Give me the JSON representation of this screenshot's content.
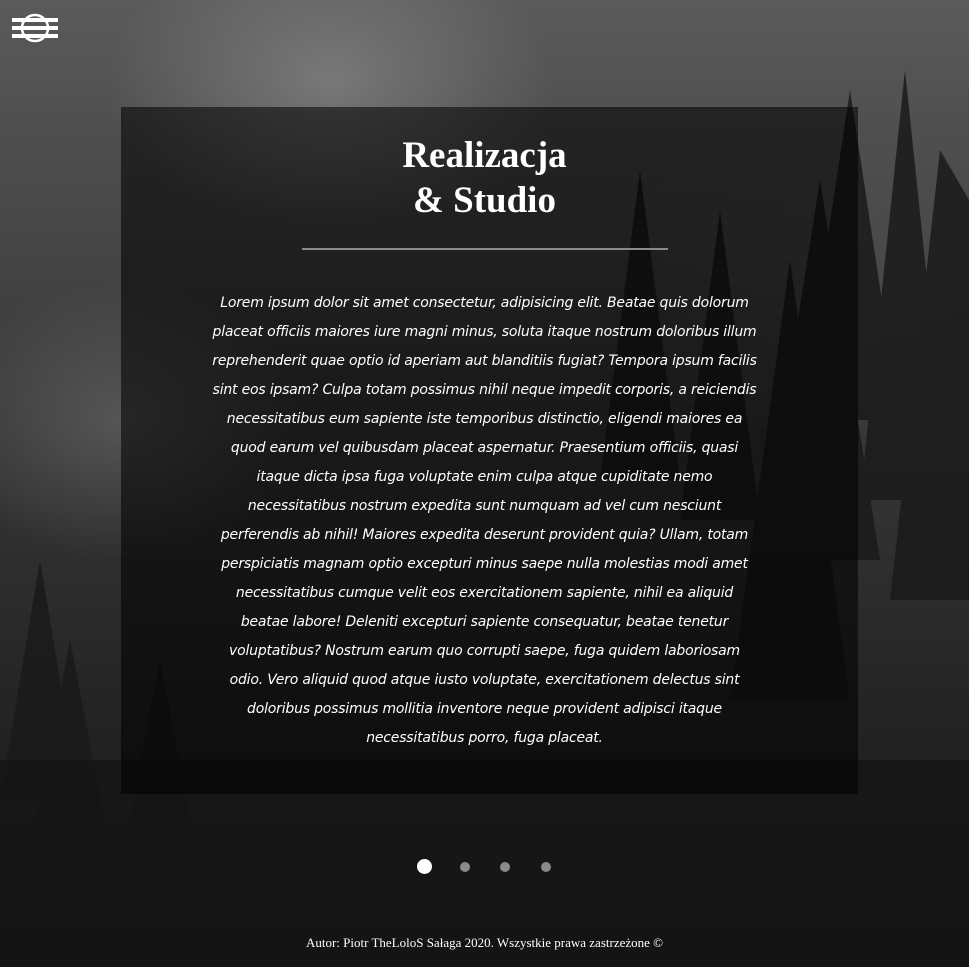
{
  "menu": {
    "icon": "hamburger-menu-icon"
  },
  "section": {
    "title_line1": "Realizacja",
    "title_line2": "& Studio",
    "text": "Lorem ipsum dolor sit amet consectetur, adipisicing elit. Beatae quis dolorum placeat officiis maiores iure magni minus, soluta itaque nostrum doloribus illum reprehenderit quae optio id aperiam aut blanditiis fugiat? Tempora ipsum facilis sint eos ipsam? Culpa totam possimus nihil neque impedit corporis, a reiciendis necessitatibus eum sapiente iste temporibus distinctio, eligendi maiores ea quod earum vel quibusdam placeat aspernatur. Praesentium officiis, quasi itaque dicta ipsa fuga voluptate enim culpa atque cupiditate nemo necessitatibus nostrum expedita sunt numquam ad vel cum nesciunt perferendis ab nihil! Maiores expedita deserunt provident quia? Ullam, totam perspiciatis magnam optio excepturi minus saepe nulla molestias modi amet necessitatibus cumque velit eos exercitationem sapiente, nihil ea aliquid beatae labore! Deleniti excepturi sapiente consequatur, beatae tenetur voluptatibus? Nostrum earum quo corrupti saepe, fuga quidem laboriosam odio. Vero aliquid quod atque iusto voluptate, exercitationem delectus sint doloribus possimus mollitia inventore neque provident adipisci itaque necessitatibus porro, fuga placeat."
  },
  "slider": {
    "count": 4,
    "active": 1
  },
  "footer": {
    "text": "Autor: Piotr TheLoloS Sałaga 2020. Wszystkie prawa zastrzeżone ©"
  },
  "colors": {
    "accent": "#ffffff",
    "inactive_dot": "#8a8a8a",
    "panel": "#000000"
  }
}
